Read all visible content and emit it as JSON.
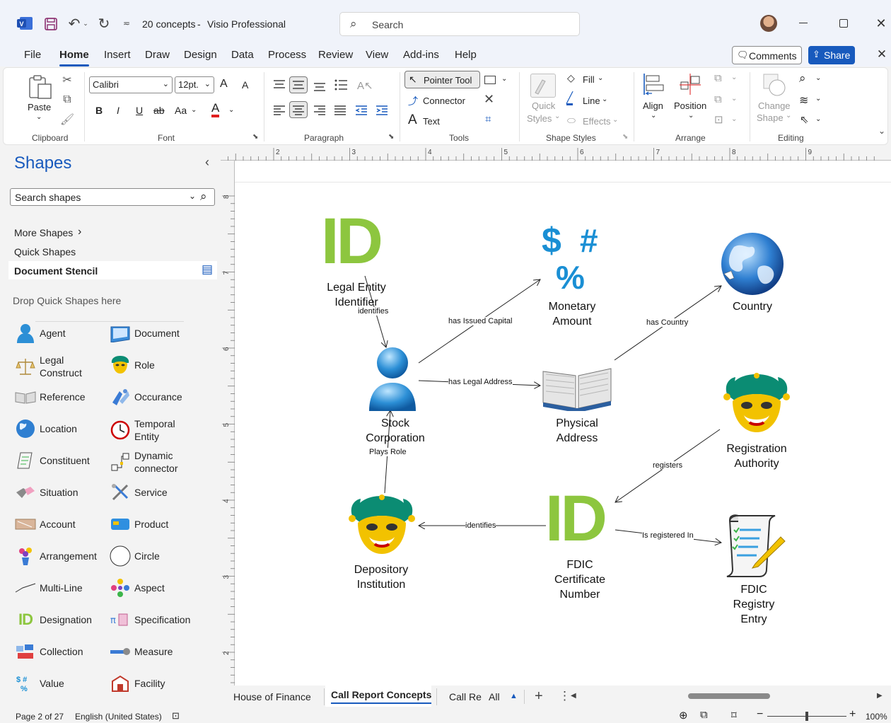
{
  "app": {
    "doc_title": "20 concepts",
    "separator": "-",
    "app_name": "Visio Professional",
    "search_placeholder": "Search"
  },
  "menu": [
    "File",
    "Home",
    "Insert",
    "Draw",
    "Design",
    "Data",
    "Process",
    "Review",
    "View",
    "Add-ins",
    "Help"
  ],
  "header_buttons": {
    "comments": "Comments",
    "share": "Share"
  },
  "ribbon": {
    "clipboard": {
      "label": "Clipboard",
      "paste": "Paste"
    },
    "font": {
      "label": "Font",
      "family": "Calibri",
      "size": "12pt.",
      "bold": "B",
      "italic": "I",
      "underline": "U",
      "strike": "ab",
      "case": "Aa",
      "color": "A",
      "grow": "A",
      "shrink": "A"
    },
    "paragraph": {
      "label": "Paragraph"
    },
    "tools": {
      "label": "Tools",
      "pointer": "Pointer Tool",
      "connector": "Connector",
      "text": "Text",
      "text_glyph": "A"
    },
    "shape_styles": {
      "label": "Shape Styles",
      "quick_styles": [
        "Quick",
        "Styles"
      ],
      "fill": "Fill",
      "line": "Line",
      "effects": "Effects"
    },
    "arrange": {
      "label": "Arrange",
      "align": "Align",
      "position": "Position"
    },
    "editing": {
      "label": "Editing",
      "change_shape": [
        "Change",
        "Shape"
      ]
    }
  },
  "shapes_pane": {
    "title": "Shapes",
    "search_placeholder": "Search shapes",
    "more_shapes": "More Shapes",
    "quick_shapes": "Quick Shapes",
    "document_stencil": "Document Stencil",
    "drop_hint": "Drop Quick Shapes here",
    "items": [
      {
        "label": "Agent",
        "icon": "agent-icon"
      },
      {
        "label": "Document",
        "icon": "document-icon"
      },
      {
        "label": "Legal\nConstruct",
        "icon": "scales-icon"
      },
      {
        "label": "Role",
        "icon": "jester-mask-icon"
      },
      {
        "label": "Reference",
        "icon": "book-icon"
      },
      {
        "label": "Occurance",
        "icon": "occurance-icon"
      },
      {
        "label": "Location",
        "icon": "globe-icon"
      },
      {
        "label": "Temporal\nEntity",
        "icon": "clock-icon"
      },
      {
        "label": "Constituent",
        "icon": "scroll-icon"
      },
      {
        "label": "Dynamic\nconnector",
        "icon": "dynamic-connector-icon"
      },
      {
        "label": "Situation",
        "icon": "situation-icon"
      },
      {
        "label": "Service",
        "icon": "tools-icon"
      },
      {
        "label": "Account",
        "icon": "account-icon"
      },
      {
        "label": "Product",
        "icon": "product-icon"
      },
      {
        "label": "Arrangement",
        "icon": "flower-vase-icon"
      },
      {
        "label": "Circle",
        "icon": "circle-icon"
      },
      {
        "label": "Multi-Line",
        "icon": "multi-line-icon"
      },
      {
        "label": "Aspect",
        "icon": "aspect-icon"
      },
      {
        "label": "Designation",
        "icon": "id-icon"
      },
      {
        "label": "Specification",
        "icon": "specification-icon"
      },
      {
        "label": "Collection",
        "icon": "collection-icon"
      },
      {
        "label": "Measure",
        "icon": "measure-icon"
      },
      {
        "label": "Value",
        "icon": "value-icon"
      },
      {
        "label": "Facility",
        "icon": "facility-icon"
      }
    ]
  },
  "ruler": {
    "h_ticks": [
      "2",
      "3",
      "4",
      "5",
      "6",
      "7",
      "8",
      "9"
    ],
    "v_ticks": [
      "8",
      "7",
      "6",
      "5",
      "4",
      "3",
      "2"
    ]
  },
  "diagram": {
    "nodes": {
      "legal_entity_id": "Legal Entity\nIdentifier",
      "monetary_amount": "Monetary\nAmount",
      "country": "Country",
      "stock_corporation": "Stock\nCorporation",
      "physical_address": "Physical\nAddress",
      "registration_authority": "Registration\nAuthority",
      "depository_institution": "Depository\nInstitution",
      "fdic_cert": "FDIC\nCertificate\nNumber",
      "fdic_registry": "FDIC\nRegistry\nEntry"
    },
    "edges": {
      "identifies_1": "identifies",
      "has_issued_capital": "has Issued Capital",
      "has_country": "has Country",
      "has_legal_address": "has Legal Address",
      "plays_role": "Plays Role",
      "registers": "registers",
      "identifies_2": "identifies",
      "is_registered_in": "Is registered In"
    },
    "glyphs": {
      "id": "ID",
      "dollar": "$",
      "hash": "#",
      "percent": "%"
    }
  },
  "tabs": [
    "House of Finance",
    "Call Report Concepts",
    "Call Rep"
  ],
  "tabs_all": "All",
  "active_tab": "Call Report Concepts",
  "status": {
    "page": "Page 2 of 27",
    "language": "English (United States)",
    "zoom": "100%",
    "zoom_value": 100
  },
  "colors": {
    "accent": "#185abd",
    "id_green": "#8dc63f",
    "money_blue": "#1a8fd4"
  }
}
